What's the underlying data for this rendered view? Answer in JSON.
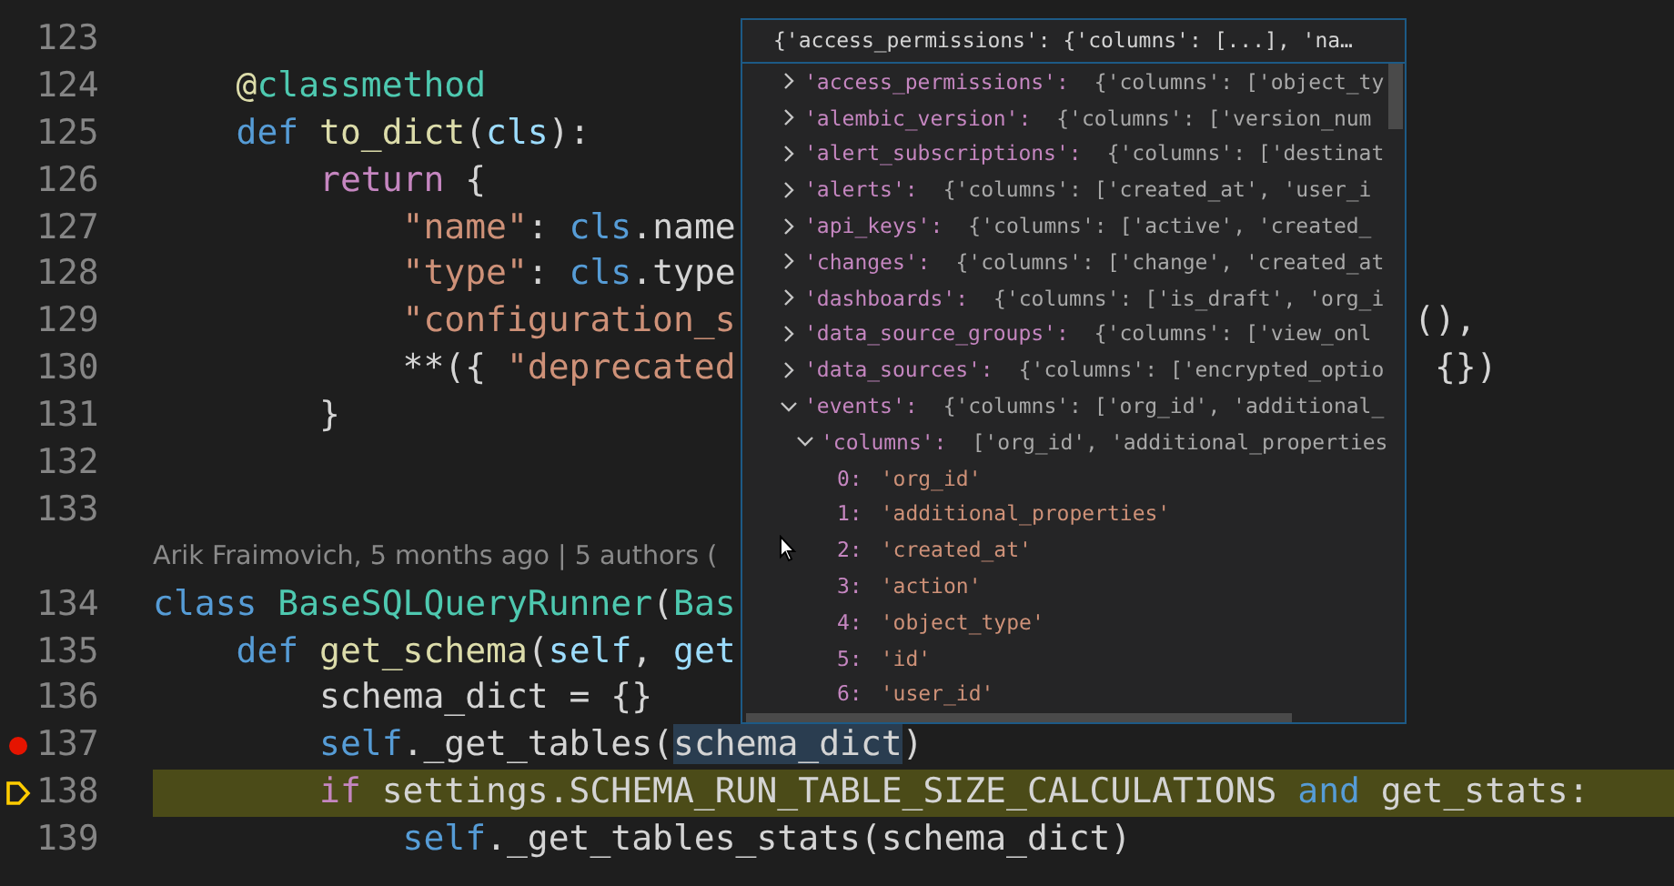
{
  "editor": {
    "lines": [
      {
        "kind": "code",
        "number": "123",
        "breakpoint": false,
        "current": false
      },
      {
        "kind": "code",
        "number": "124",
        "breakpoint": false,
        "current": false,
        "tokens": [
          {
            "text": "    @",
            "kind": "function"
          },
          {
            "text": "classmethod",
            "kind": "class"
          }
        ]
      },
      {
        "kind": "code",
        "number": "125",
        "breakpoint": false,
        "current": false,
        "tokens": [
          {
            "text": "    def",
            "kind": "keyword"
          },
          {
            "text": " to_dict",
            "kind": "function"
          },
          {
            "text": "(",
            "kind": "plain"
          },
          {
            "text": "cls",
            "kind": "variable"
          },
          {
            "text": "):",
            "kind": "plain"
          }
        ]
      },
      {
        "kind": "code",
        "number": "126",
        "breakpoint": false,
        "current": false,
        "tokens": [
          {
            "text": "        return",
            "kind": "control"
          },
          {
            "text": " {",
            "kind": "plain"
          }
        ]
      },
      {
        "kind": "code",
        "number": "127",
        "breakpoint": false,
        "current": false,
        "tokens": [
          {
            "text": "            \"name\"",
            "kind": "string"
          },
          {
            "text": ": ",
            "kind": "plain"
          },
          {
            "text": "cls",
            "kind": "keyword"
          },
          {
            "text": ".name",
            "kind": "plain"
          }
        ]
      },
      {
        "kind": "code",
        "number": "128",
        "breakpoint": false,
        "current": false,
        "tokens": [
          {
            "text": "            \"type\"",
            "kind": "string"
          },
          {
            "text": ": ",
            "kind": "plain"
          },
          {
            "text": "cls",
            "kind": "keyword"
          },
          {
            "text": ".type",
            "kind": "plain"
          }
        ]
      },
      {
        "kind": "code",
        "number": "129",
        "breakpoint": false,
        "current": false,
        "tokens": [
          {
            "text": "            \"configuration_s",
            "kind": "string"
          }
        ],
        "tail": [
          {
            "text": "(),",
            "kind": "plain"
          }
        ]
      },
      {
        "kind": "code",
        "number": "130",
        "breakpoint": false,
        "current": false,
        "tokens": [
          {
            "text": "            **({ ",
            "kind": "plain"
          },
          {
            "text": "\"deprecated",
            "kind": "string"
          }
        ],
        "tail": [
          {
            "text": " {})",
            "kind": "plain"
          }
        ]
      },
      {
        "kind": "code",
        "number": "131",
        "breakpoint": false,
        "current": false,
        "tokens": [
          {
            "text": "        }",
            "kind": "plain"
          }
        ]
      },
      {
        "kind": "code",
        "number": "132",
        "breakpoint": false,
        "current": false
      },
      {
        "kind": "code",
        "number": "133",
        "breakpoint": false,
        "current": false
      },
      {
        "kind": "blame",
        "text": "Arik Fraimovich, 5 months ago | 5 authors ("
      },
      {
        "kind": "code",
        "number": "134",
        "breakpoint": false,
        "current": false,
        "tokens": [
          {
            "text": "class",
            "kind": "keyword"
          },
          {
            "text": " BaseSQLQueryRunner",
            "kind": "class"
          },
          {
            "text": "(",
            "kind": "plain"
          },
          {
            "text": "Bas",
            "kind": "class"
          }
        ]
      },
      {
        "kind": "code",
        "number": "135",
        "breakpoint": false,
        "current": false,
        "tokens": [
          {
            "text": "    def",
            "kind": "keyword"
          },
          {
            "text": " get_schema",
            "kind": "function"
          },
          {
            "text": "(",
            "kind": "plain"
          },
          {
            "text": "self",
            "kind": "variable"
          },
          {
            "text": ", ",
            "kind": "plain"
          },
          {
            "text": "get",
            "kind": "variable"
          }
        ]
      },
      {
        "kind": "code",
        "number": "136",
        "breakpoint": false,
        "current": false,
        "tokens": [
          {
            "text": "        schema_dict = {}",
            "kind": "plain"
          }
        ]
      },
      {
        "kind": "code",
        "number": "137",
        "breakpoint": true,
        "current": false,
        "tokens": [
          {
            "text": "        self",
            "kind": "keyword"
          },
          {
            "text": "._get_tables(",
            "kind": "plain"
          },
          {
            "text": "schema_dict",
            "kind": "plain",
            "highlighted": true
          },
          {
            "text": ")",
            "kind": "plain"
          }
        ]
      },
      {
        "kind": "code",
        "number": "138",
        "breakpoint": false,
        "current": true,
        "tokens": [
          {
            "text": "        if",
            "kind": "control"
          },
          {
            "text": " settings.SCHEMA_RUN_TABLE_SIZE_CALCULATIONS ",
            "kind": "plain"
          },
          {
            "text": "and",
            "kind": "keyword"
          },
          {
            "text": " get_stats:",
            "kind": "plain"
          }
        ]
      },
      {
        "kind": "code",
        "number": "139",
        "breakpoint": false,
        "current": false,
        "tokens": [
          {
            "text": "            self",
            "kind": "keyword"
          },
          {
            "text": "._get_tables_stats(schema_dict)",
            "kind": "plain"
          }
        ]
      }
    ]
  },
  "hover": {
    "header": "{'access_permissions': {'columns': [...], 'na…",
    "items": [
      {
        "key": "'access_permissions':",
        "value": "{'columns': ['object_ty",
        "expanded": false
      },
      {
        "key": "'alembic_version':",
        "value": "{'columns': ['version_num",
        "expanded": false
      },
      {
        "key": "'alert_subscriptions':",
        "value": "{'columns': ['destinat",
        "expanded": false
      },
      {
        "key": "'alerts':",
        "value": "{'columns': ['created_at', 'user_i",
        "expanded": false
      },
      {
        "key": "'api_keys':",
        "value": "{'columns': ['active', 'created_",
        "expanded": false
      },
      {
        "key": "'changes':",
        "value": "{'columns': ['change', 'created_at",
        "expanded": false
      },
      {
        "key": "'dashboards':",
        "value": "{'columns': ['is_draft', 'org_i",
        "expanded": false
      },
      {
        "key": "'data_source_groups':",
        "value": "{'columns': ['view_onl",
        "expanded": false
      },
      {
        "key": "'data_sources':",
        "value": "{'columns': ['encrypted_optio",
        "expanded": false
      },
      {
        "key": "'events':",
        "value": "{'columns': ['org_id', 'additional_",
        "expanded": true,
        "children": [
          {
            "key": "'columns':",
            "value": "['org_id', 'additional_properties",
            "expanded": true,
            "children": [
              {
                "key": "0:",
                "value": "'org_id'"
              },
              {
                "key": "1:",
                "value": "'additional_properties'"
              },
              {
                "key": "2:",
                "value": "'created_at'"
              },
              {
                "key": "3:",
                "value": "'action'"
              },
              {
                "key": "4:",
                "value": "'object_type'"
              },
              {
                "key": "5:",
                "value": "'id'"
              },
              {
                "key": "6:",
                "value": "'user_id'"
              }
            ]
          }
        ]
      }
    ]
  }
}
